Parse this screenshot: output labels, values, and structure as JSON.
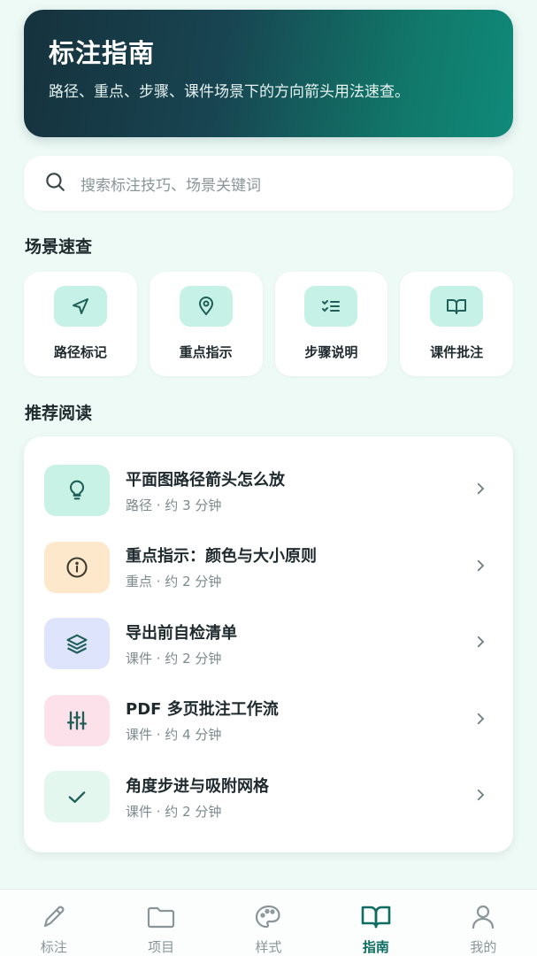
{
  "hero": {
    "title": "标注指南",
    "subtitle": "路径、重点、步骤、课件场景下的方向箭头用法速查。"
  },
  "search": {
    "placeholder": "搜索标注技巧、场景关键词"
  },
  "scenes": {
    "title": "场景速查",
    "items": [
      {
        "label": "路径标记",
        "icon": "navigation-arrow-icon"
      },
      {
        "label": "重点指示",
        "icon": "map-pin-icon"
      },
      {
        "label": "步骤说明",
        "icon": "checklist-icon"
      },
      {
        "label": "课件批注",
        "icon": "open-book-icon"
      }
    ]
  },
  "recommended": {
    "title": "推荐阅读",
    "items": [
      {
        "title": "平面图路径箭头怎么放",
        "meta": "路径 · 约 3 分钟",
        "icon": "lightbulb-icon",
        "icon_bg": "#c9f2e6"
      },
      {
        "title": "重点指示：颜色与大小原则",
        "meta": "重点 · 约 2 分钟",
        "icon": "info-icon",
        "icon_bg": "#fde8cc"
      },
      {
        "title": "导出前自检清单",
        "meta": "课件 · 约 2 分钟",
        "icon": "layers-icon",
        "icon_bg": "#dde4fb"
      },
      {
        "title": "PDF 多页批注工作流",
        "meta": "课件 · 约 4 分钟",
        "icon": "sliders-icon",
        "icon_bg": "#fde1ea"
      },
      {
        "title": "角度步进与吸附网格",
        "meta": "课件 · 约 2 分钟",
        "icon": "check-icon",
        "icon_bg": "#e3f7ee"
      }
    ]
  },
  "tabbar": {
    "active": "指南",
    "items": [
      {
        "label": "标注",
        "icon": "pencil-icon"
      },
      {
        "label": "项目",
        "icon": "folder-icon"
      },
      {
        "label": "样式",
        "icon": "palette-icon"
      },
      {
        "label": "指南",
        "icon": "book-icon"
      },
      {
        "label": "我的",
        "icon": "user-icon"
      }
    ]
  },
  "colors": {
    "accent": "#0e6d60",
    "icon_stroke": "#1f5f58",
    "background": "#eefaf6"
  }
}
